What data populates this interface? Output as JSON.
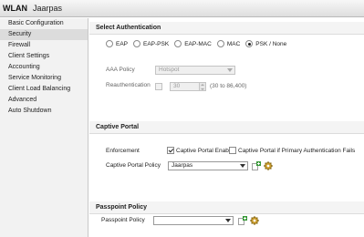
{
  "window": {
    "title_label": "WLAN",
    "title_name": "Jaarpas"
  },
  "sidebar": {
    "items": [
      {
        "label": "Basic Configuration",
        "active": false
      },
      {
        "label": "Security",
        "active": true
      },
      {
        "label": "Firewall",
        "active": false
      },
      {
        "label": "Client Settings",
        "active": false
      },
      {
        "label": "Accounting",
        "active": false
      },
      {
        "label": "Service Monitoring",
        "active": false
      },
      {
        "label": "Client Load Balancing",
        "active": false
      },
      {
        "label": "Advanced",
        "active": false
      },
      {
        "label": "Auto Shutdown",
        "active": false
      }
    ]
  },
  "select_authentication": {
    "heading": "Select Authentication",
    "options": [
      {
        "label": "EAP",
        "checked": false
      },
      {
        "label": "EAP-PSK",
        "checked": false
      },
      {
        "label": "EAP-MAC",
        "checked": false
      },
      {
        "label": "MAC",
        "checked": false
      },
      {
        "label": "PSK / None",
        "checked": true
      }
    ],
    "aaa_policy_label": "AAA Policy",
    "aaa_policy_value": "Hotspot",
    "reauth_label": "Reauthentication",
    "reauth_value": "30",
    "reauth_range": "(30 to 86,400)"
  },
  "captive_portal": {
    "heading": "Captive Portal",
    "enforcement_label": "Enforcement",
    "enable_label": "Captive Portal Enable",
    "enable_checked": true,
    "if_primary_fails_label": "Captive Portal if Primary Authentication Fails",
    "if_primary_fails_checked": false,
    "policy_label": "Captive Portal Policy",
    "policy_value": "Jaarpas"
  },
  "passpoint": {
    "heading": "Passpoint Policy",
    "policy_label": "Passpoint Policy",
    "policy_value": ""
  },
  "colors": {
    "icon_green": "#3a9a3a",
    "gear": "#c89a2a"
  },
  "icons": {
    "create": "create-policy-icon",
    "edit": "gear-icon"
  }
}
